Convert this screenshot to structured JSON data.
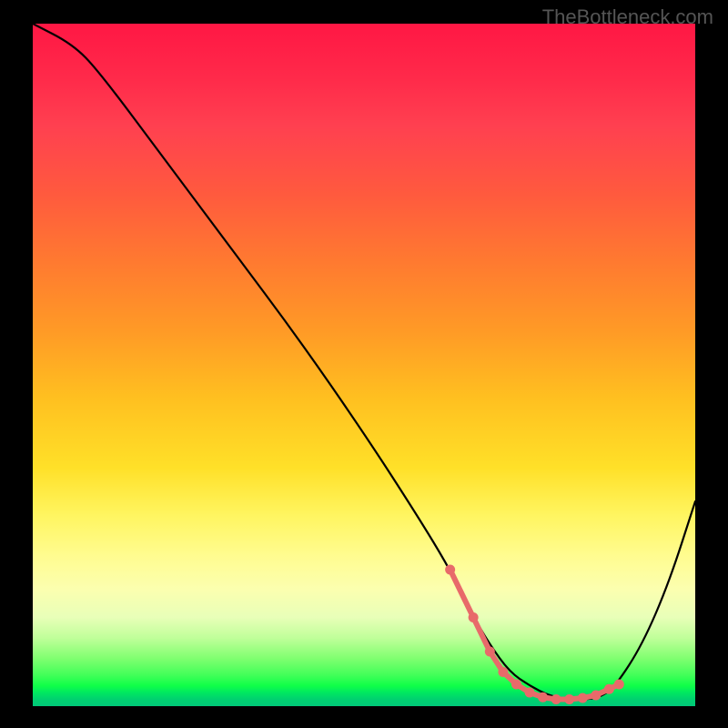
{
  "watermark": "TheBottleneck.com",
  "chart_data": {
    "type": "line",
    "title": "",
    "xlabel": "",
    "ylabel": "",
    "xlim": [
      0,
      100
    ],
    "ylim": [
      0,
      100
    ],
    "series": [
      {
        "name": "bottleneck-curve",
        "x": [
          0,
          6,
          10,
          20,
          30,
          40,
          50,
          58,
          63,
          66,
          69,
          72,
          75,
          78,
          81,
          84,
          86,
          88,
          92,
          96,
          100
        ],
        "y": [
          100,
          97,
          93,
          80,
          67,
          54,
          40,
          28,
          20,
          14,
          9,
          5,
          3,
          1.5,
          1,
          1,
          1.5,
          3,
          9,
          18,
          30
        ]
      }
    ],
    "markers": {
      "name": "highlight-points",
      "color": "#e86a6a",
      "x": [
        63,
        66.5,
        69,
        71,
        73,
        75,
        77,
        79,
        81,
        83,
        85,
        87,
        88.5
      ],
      "y": [
        20,
        13,
        8,
        5,
        3.2,
        2,
        1.3,
        1,
        1,
        1.2,
        1.6,
        2.5,
        3.2
      ]
    }
  }
}
